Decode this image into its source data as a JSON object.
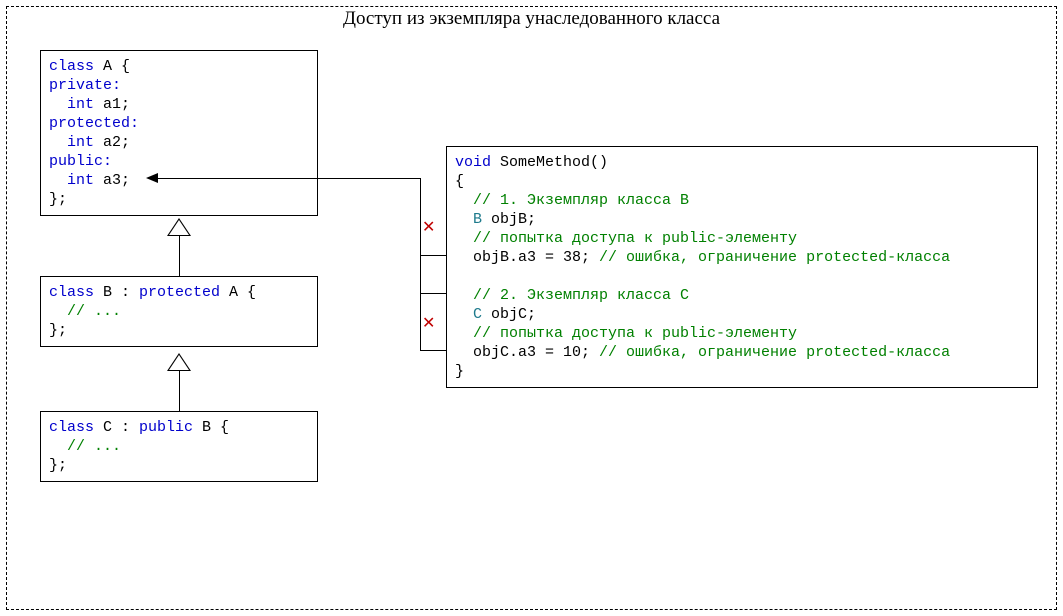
{
  "title": "Доступ из экземпляра унаследованного класса",
  "classA": {
    "l1_a": "class",
    "l1_b": " A {",
    "l2": "private:",
    "l3_a": "  int",
    "l3_b": " a1;",
    "l4": "protected:",
    "l5_a": "  int",
    "l5_b": " a2;",
    "l6": "public:",
    "l7_a": "  int",
    "l7_b": " a3;",
    "l8": "};"
  },
  "classB": {
    "l1_a": "class",
    "l1_b": " B : ",
    "l1_c": "protected",
    "l1_d": " A {",
    "l2": "  // ...",
    "l3": "};"
  },
  "classC": {
    "l1_a": "class",
    "l1_b": " C : ",
    "l1_c": "public",
    "l1_d": " B {",
    "l2": "  // ...",
    "l3": "};"
  },
  "method": {
    "l1_a": "void",
    "l1_b": " SomeMethod()",
    "l2": "{",
    "l3": "  // 1. Экземпляр класса B",
    "l4_a": "  B",
    "l4_b": " objB;",
    "l5": "  // попытка доступа к public-элементу",
    "l6_a": "  objB.a3 = 38; ",
    "l6_b": "// ошибка, ограничение protected-класса",
    "l7": " ",
    "l8": "  // 2. Экземпляр класса C",
    "l9_a": "  C",
    "l9_b": " objC;",
    "l10": "  // попытка доступа к public-элементу",
    "l11_a": "  objC.a3 = 10; ",
    "l11_b": "// ошибка, ограничение protected-класса",
    "l12": "}"
  },
  "x1": "✕",
  "x2": "✕"
}
